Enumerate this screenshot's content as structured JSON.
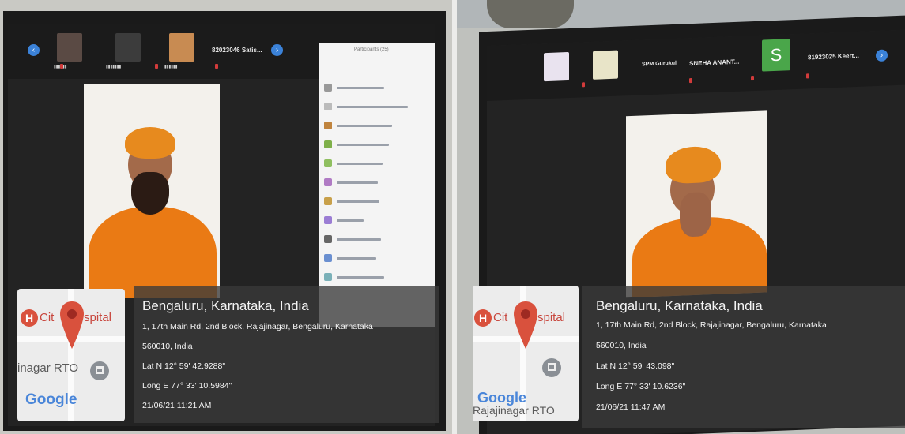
{
  "photos": [
    {
      "id": "left",
      "meeting": {
        "participants_top": [
          "",
          "",
          "",
          "82023046 Satis..."
        ],
        "panel_title": "Participants (25)"
      },
      "geo": {
        "city": "Bengaluru, Karnataka, India",
        "address": "1, 17th Main Rd, 2nd Block, Rajajinagar, Bengaluru, Karnataka",
        "postal": "560010, India",
        "lat": "Lat N 12° 59' 42.9288\"",
        "long": "Long E 77° 33' 10.5984\"",
        "timestamp": "21/06/21 11:21 AM"
      },
      "map": {
        "hospital_label_a": "Cit",
        "hospital_label_b": "spital",
        "rto_label": "inagar RTO",
        "google": "Google"
      }
    },
    {
      "id": "right",
      "meeting": {
        "participants_top": [
          "",
          "",
          "SPM Gurukul",
          "SNEHA ANANT...",
          "S",
          "81923025 Keert..."
        ]
      },
      "geo": {
        "city": "Bengaluru, Karnataka, India",
        "address": "1, 17th Main Rd, 2nd Block, Rajajinagar, Bengaluru, Karnataka",
        "postal": "560010, India",
        "lat": "Lat N 12° 59' 43.098\"",
        "long": "Long E 77° 33' 10.6236\"",
        "timestamp": "21/06/21 11:47 AM"
      },
      "map": {
        "hospital_label_a": "Cit",
        "hospital_label_b": "spital",
        "rto_label": "Rajajinagar RTO",
        "google": "Google"
      }
    }
  ],
  "colors": {
    "robe": "#ea7a14",
    "turban": "#e78a1e",
    "zoom_blue": "#3b82d8",
    "pin_red": "#d9513d"
  }
}
